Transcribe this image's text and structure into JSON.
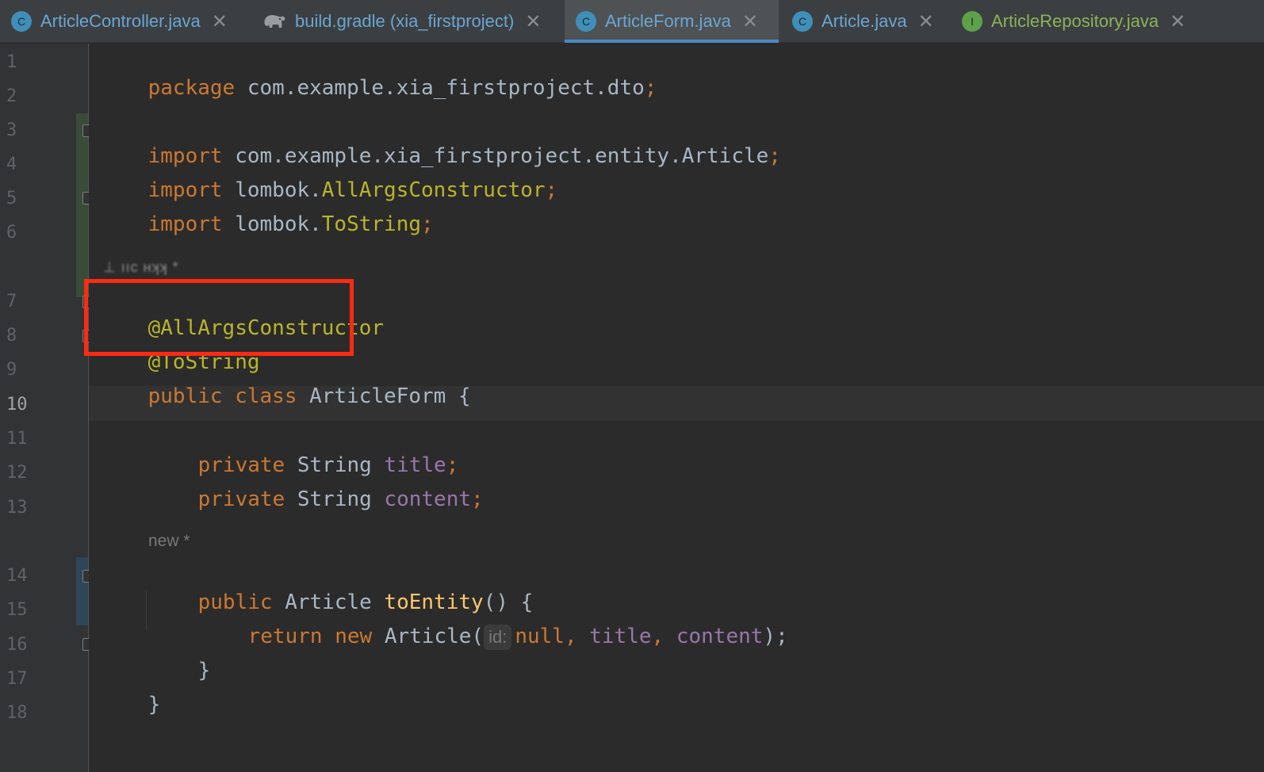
{
  "tabs": [
    {
      "label": "ArticleController.java",
      "icon": "class-icon",
      "icon_text": "C",
      "active": false
    },
    {
      "label": "build.gradle (xia_firstproject)",
      "icon": "gradle-elephant-icon",
      "icon_text": "",
      "active": false
    },
    {
      "label": "ArticleForm.java",
      "icon": "class-icon",
      "icon_text": "C",
      "active": true
    },
    {
      "label": "Article.java",
      "icon": "class-icon",
      "icon_text": "C",
      "active": false
    },
    {
      "label": "ArticleRepository.java",
      "icon": "interface-icon",
      "icon_text": "I",
      "active": false
    }
  ],
  "tab_close_glyph": "✕",
  "gutter": {
    "line_numbers": [
      "1",
      "2",
      "3",
      "4",
      "5",
      "6",
      "7",
      "8",
      "9",
      "10",
      "11",
      "12",
      "13",
      "14",
      "15",
      "16",
      "17",
      "18"
    ],
    "current_line": "10"
  },
  "code": {
    "line1": {
      "kw": "package",
      "rest": " com.example.xia_firstproject.dto",
      "semi": ";"
    },
    "line3": {
      "kw": "import",
      "rest": " com.example.xia_firstproject.entity.Article",
      "semi": ";"
    },
    "line4": {
      "kw": "import",
      "pkg": " lombok.",
      "ann": "AllArgsConstructor",
      "semi": ";"
    },
    "line5": {
      "kw": "import",
      "pkg": " lombok.",
      "ann": "ToString",
      "semi": ";"
    },
    "line7": {
      "ann": "@AllArgsConstructor"
    },
    "line8": {
      "ann": "@ToString"
    },
    "line9": {
      "kw1": "public",
      "kw2": " class",
      "name": " ArticleForm",
      "brace": " {"
    },
    "line11": {
      "kw": "private",
      "type": " String",
      "field": " title",
      "semi": ";"
    },
    "line12": {
      "kw": "private",
      "type": " String",
      "field": " content",
      "semi": ";"
    },
    "line14": {
      "kw": "public",
      "type": " Article",
      "method": " toEntity",
      "rest": "() {"
    },
    "line15": {
      "kw1": "return",
      "kw2": " new",
      "type": " Article(",
      "hint": "id:",
      "null_kw": "null",
      "comma1": ", ",
      "f1": "title",
      "comma2": ", ",
      "f2": "content",
      "end": ");"
    },
    "line16": {
      "brace": "}"
    },
    "line17": {
      "brace": "}"
    }
  },
  "inlays": {
    "author_blurred": "⊥ ııc ʜʞʞ *",
    "new_marker": "new *"
  },
  "colors": {
    "keyword": "#cc7832",
    "annotation": "#bbb529",
    "field": "#9876aa",
    "method": "#ffc66d",
    "highlight_box": "#ff2a12"
  }
}
